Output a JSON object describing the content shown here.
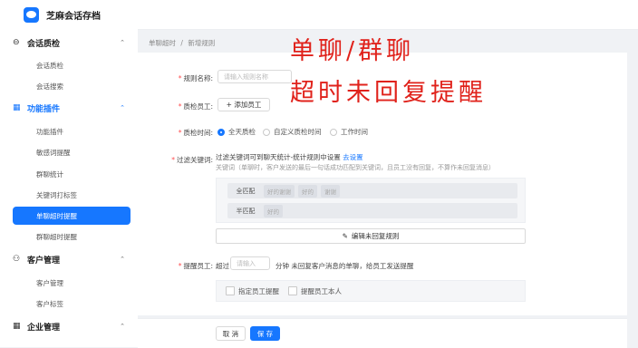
{
  "app": {
    "title": "芝麻会话存档"
  },
  "sidebar": {
    "groups": [
      {
        "icon": "⊖",
        "label": "会话质检",
        "items": [
          "会话质检",
          "会话搜索"
        ]
      },
      {
        "icon": "▦",
        "label": "功能插件",
        "items": [
          "功能插件",
          "敏感词提醒",
          "群聊统计",
          "关键词打标签",
          "单聊超时提醒",
          "群聊超时提醒"
        ]
      },
      {
        "icon": "⚇",
        "label": "客户管理",
        "items": [
          "客户管理",
          "客户标签"
        ]
      },
      {
        "icon": "▦",
        "label": "企业管理",
        "items": []
      }
    ],
    "active_item": "单聊超时提醒"
  },
  "breadcrumb": {
    "parent": "单聊超时",
    "sep": "/",
    "current": "新增规则"
  },
  "form": {
    "rule_name": {
      "label": "规则名称:",
      "placeholder": "请输入规则名称"
    },
    "staff": {
      "label": "质检员工:",
      "button": "+ 添加员工"
    },
    "time": {
      "label": "质检时间:",
      "options": [
        "全天质检",
        "自定义质检时间",
        "工作时间"
      ],
      "selected": "全天质检"
    },
    "keywords": {
      "label": "过滤关键词:",
      "desc": "过滤关键词可到聊天统计-统计规则中设置",
      "link": "去设置",
      "note": "关键词（单聊时，客户发送的最后一句话成功匹配到关键词，且员工没有回复，不算作未回复消息）",
      "full_match": {
        "label": "全匹配",
        "tags": [
          "好的谢谢",
          "好的",
          "谢谢"
        ]
      },
      "half_match": {
        "label": "半匹配",
        "tags": [
          "好的"
        ]
      },
      "edit_button": "编辑未回复规则"
    },
    "remind": {
      "label": "提醒员工:",
      "prefix": "超过",
      "placeholder": "请输入",
      "suffix": "分钟 未回复客户消息的单聊，给员工发送提醒",
      "checks": [
        "指定员工提醒",
        "提醒员工本人"
      ]
    }
  },
  "footer": {
    "cancel": "取 消",
    "save": "保 存"
  },
  "overlay": {
    "line1": "单聊/群聊",
    "line2": "超时未回复提醒"
  },
  "colors": {
    "accent": "#1677ff",
    "overlay_red": "#e0221b",
    "required": "#ff4d4f"
  }
}
